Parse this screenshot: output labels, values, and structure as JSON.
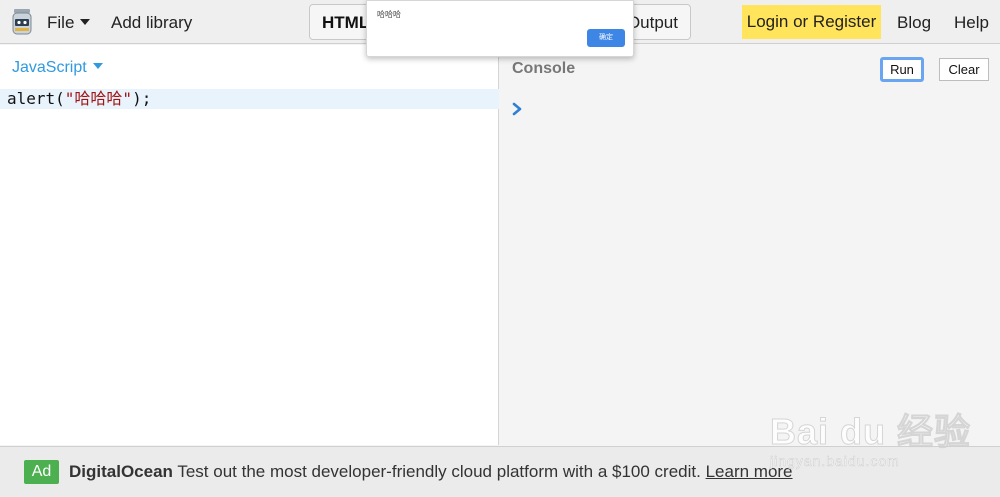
{
  "menu": {
    "file_label": "File",
    "add_library_label": "Add library",
    "login_label": "Login or Register",
    "blog_label": "Blog",
    "help_label": "Help"
  },
  "tabs": {
    "html_label": "HTML",
    "output_label": "Output"
  },
  "editor": {
    "language": "JavaScript",
    "code_prefix": "alert(",
    "code_string": "\"哈哈哈\"",
    "code_suffix": ");"
  },
  "console": {
    "title": "Console",
    "run_label": "Run",
    "clear_label": "Clear"
  },
  "ad": {
    "badge": "Ad",
    "brand": "DigitalOcean",
    "text": "Test out the most developer-friendly cloud platform with a $100 credit.",
    "link_label": "Learn more"
  },
  "alert": {
    "message": "哈哈哈",
    "ok_label": "确定"
  },
  "watermark": {
    "brand": "Bai du 经验",
    "sub": "jingyan.baidu.com"
  },
  "colors": {
    "accent_blue": "#2f9ae0",
    "login_yellow": "#ffe45c",
    "ad_green": "#4caf50",
    "ok_blue": "#3e86e5"
  },
  "icons": {
    "logo": "jar-logo-icon",
    "prompt": "chevron-right-icon"
  }
}
